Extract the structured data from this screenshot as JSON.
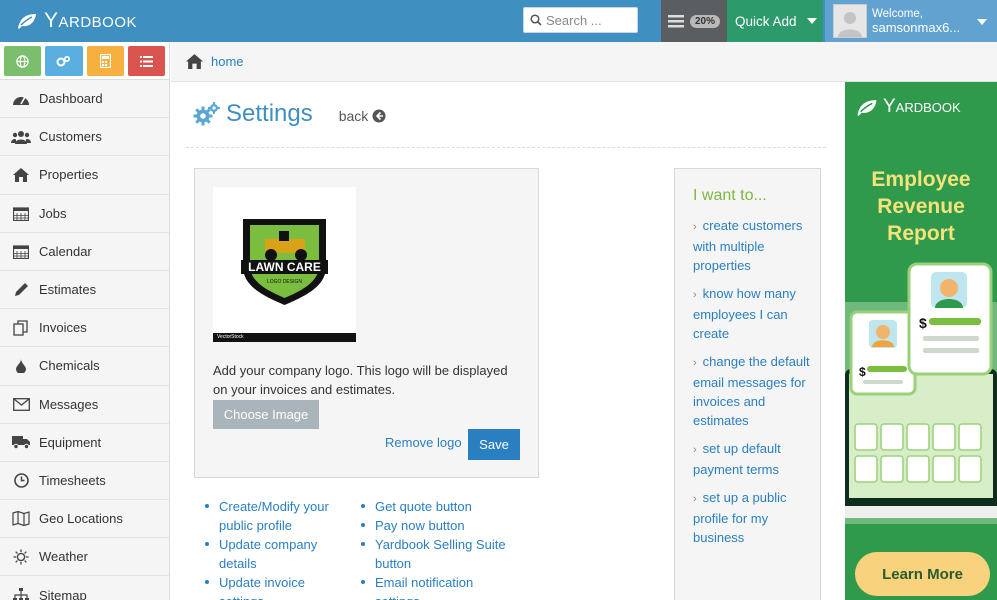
{
  "header": {
    "brand": "Yardbook",
    "search_placeholder": "Search ...",
    "progress": "20%",
    "quick_add": "Quick Add",
    "welcome": "Welcome,",
    "username": "samsonmax6..."
  },
  "sidebar": {
    "items": [
      {
        "label": "Dashboard",
        "icon": "dashboard-icon"
      },
      {
        "label": "Customers",
        "icon": "users-icon"
      },
      {
        "label": "Properties",
        "icon": "home-icon"
      },
      {
        "label": "Jobs",
        "icon": "calendar-grid-icon"
      },
      {
        "label": "Calendar",
        "icon": "calendar-icon"
      },
      {
        "label": "Estimates",
        "icon": "pencil-icon"
      },
      {
        "label": "Invoices",
        "icon": "copy-icon"
      },
      {
        "label": "Chemicals",
        "icon": "drop-icon"
      },
      {
        "label": "Messages",
        "icon": "envelope-icon"
      },
      {
        "label": "Equipment",
        "icon": "truck-icon"
      },
      {
        "label": "Timesheets",
        "icon": "clock-icon"
      },
      {
        "label": "Geo Locations",
        "icon": "map-icon"
      },
      {
        "label": "Weather",
        "icon": "sun-icon"
      },
      {
        "label": "Sitemap",
        "icon": "sitemap-icon"
      }
    ]
  },
  "breadcrumb": {
    "home": "home"
  },
  "main": {
    "title": "Settings",
    "back": "back",
    "logo_description": "Add your company logo. This logo will be displayed on your invoices and estimates.",
    "logo_text": "LAWN CARE",
    "logo_subtext": "LOGO DESIGN",
    "logo_watermark": "VectorStock",
    "choose_image": "Choose Image",
    "remove_logo": "Remove logo",
    "save": "Save",
    "links_left": [
      "Create/Modify your public profile",
      "Update company details",
      "Update invoice settings"
    ],
    "links_right": [
      "Get quote button",
      "Pay now button",
      "Yardbook Selling Suite button",
      "Email notification settings"
    ]
  },
  "iwant": {
    "title": "I want to...",
    "items": [
      "create customers with multiple properties",
      "know how many employees I can create",
      "change the default email messages for invoices and estimates",
      "set up default payment terms",
      "set up a public profile for my business"
    ]
  },
  "ad": {
    "brand": "Yardbook",
    "title": "Employee Revenue Report",
    "cta": "Learn More"
  },
  "colors": {
    "topbar": "#3f8fc1",
    "quick_add": "#2c9a6a",
    "ad_bg": "#2f9a4c",
    "accent_green": "#7cb842"
  }
}
